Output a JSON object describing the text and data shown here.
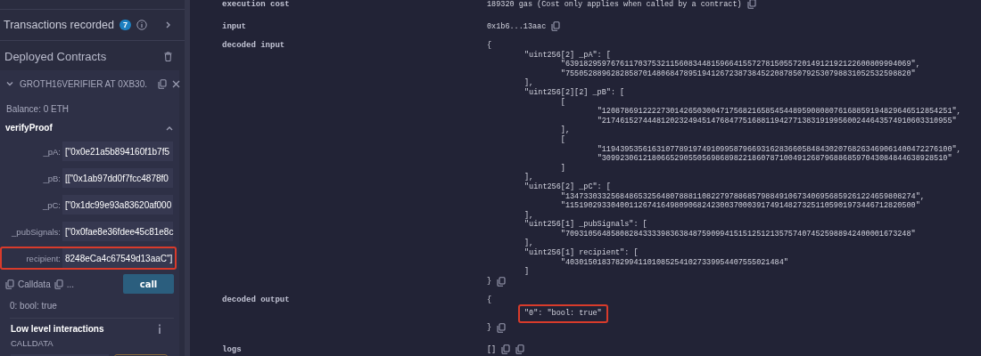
{
  "left_panel": {
    "transactions": {
      "label": "Transactions recorded",
      "count": "7"
    },
    "deployed": {
      "title": "Deployed Contracts"
    },
    "contract": {
      "name": "GROTH16VERIFIER AT 0XB30.",
      "expanded": true,
      "balance": "Balance: 0 ETH",
      "function": {
        "name": "verifyProof",
        "expanded": true,
        "params": [
          {
            "label": "_pA:",
            "value": "[\"0x0e21a5b894160f1b7f5",
            "highlighted": false
          },
          {
            "label": "_pB:",
            "value": "[[\"0x1ab97dd0f7fcc4878f0",
            "highlighted": false
          },
          {
            "label": "_pC:",
            "value": "[\"0x1dc99e93a83620af000",
            "highlighted": false
          },
          {
            "label": "_pubSignals:",
            "value": "[\"0x0fae8e36fdee45c81e8c",
            "highlighted": false
          },
          {
            "label": "recipient:",
            "value": "8248eCa4c67549d13aaC\"]",
            "highlighted": true
          }
        ]
      },
      "calldata_label": "Calldata",
      "more_label": "...",
      "call_button": "call",
      "result": "0: bool: true"
    },
    "low_level": {
      "title": "Low level interactions",
      "calldata_label": "CALLDATA"
    }
  },
  "details": {
    "rows": [
      {
        "kind": "text",
        "label": "execution cost",
        "value": "189320 gas (Cost only applies when called by a contract)"
      },
      {
        "kind": "text",
        "label": "input",
        "value": "0x1b6...13aac"
      },
      {
        "kind": "code",
        "label": "decoded input",
        "open": "{",
        "body": "\"uint256[2] _pA\": [\n\t\"6391829597676117037532115608344815966415572781505572014912192122600809994069\",\n\t\"7550528896282858701480684789519412672387384522087850792530798831052532598820\"\n],\n\"uint256[2][2] _pB\": [\n\t[\n\t\t\"12087869122227301426503004717568216585454489590808076168859194829646512854251\",\n\t\t\"21746152744481202324945147684775168811942771383191995600244643574910603310955\"\n\t],\n\t[\n\t\t\"11943953561631077891974910995879669316283660584843020768263469061400472276100\",\n\t\t\"3099230612180665290550569868982218607871004912687968868597043084844638928510\"\n\t]\n],\n\"uint256[2] _pC\": [\n\t\"13473303325684865325648078881108227978868579884910673406956859261224659808274\",\n\t\"11519029330400112674164980906824230037000391749148273251105901973446712820500\"\n],\n\"uint256[1] _pubSignals\": [\n\t\"7093105648580828433339836384875909941515125121357574074525988942400001673248\"\n],\n\"uint256[1] recipient\": [\n\t\"403015018378299411010852541027339954407555021484\"\n]",
        "close": "}",
        "highlighted": false
      },
      {
        "kind": "code",
        "label": "decoded output",
        "open": "{",
        "body": "\"0\": \"bool: true\"",
        "close": "}",
        "highlighted": true
      },
      {
        "kind": "list",
        "label": "logs",
        "value": "[]"
      }
    ]
  }
}
